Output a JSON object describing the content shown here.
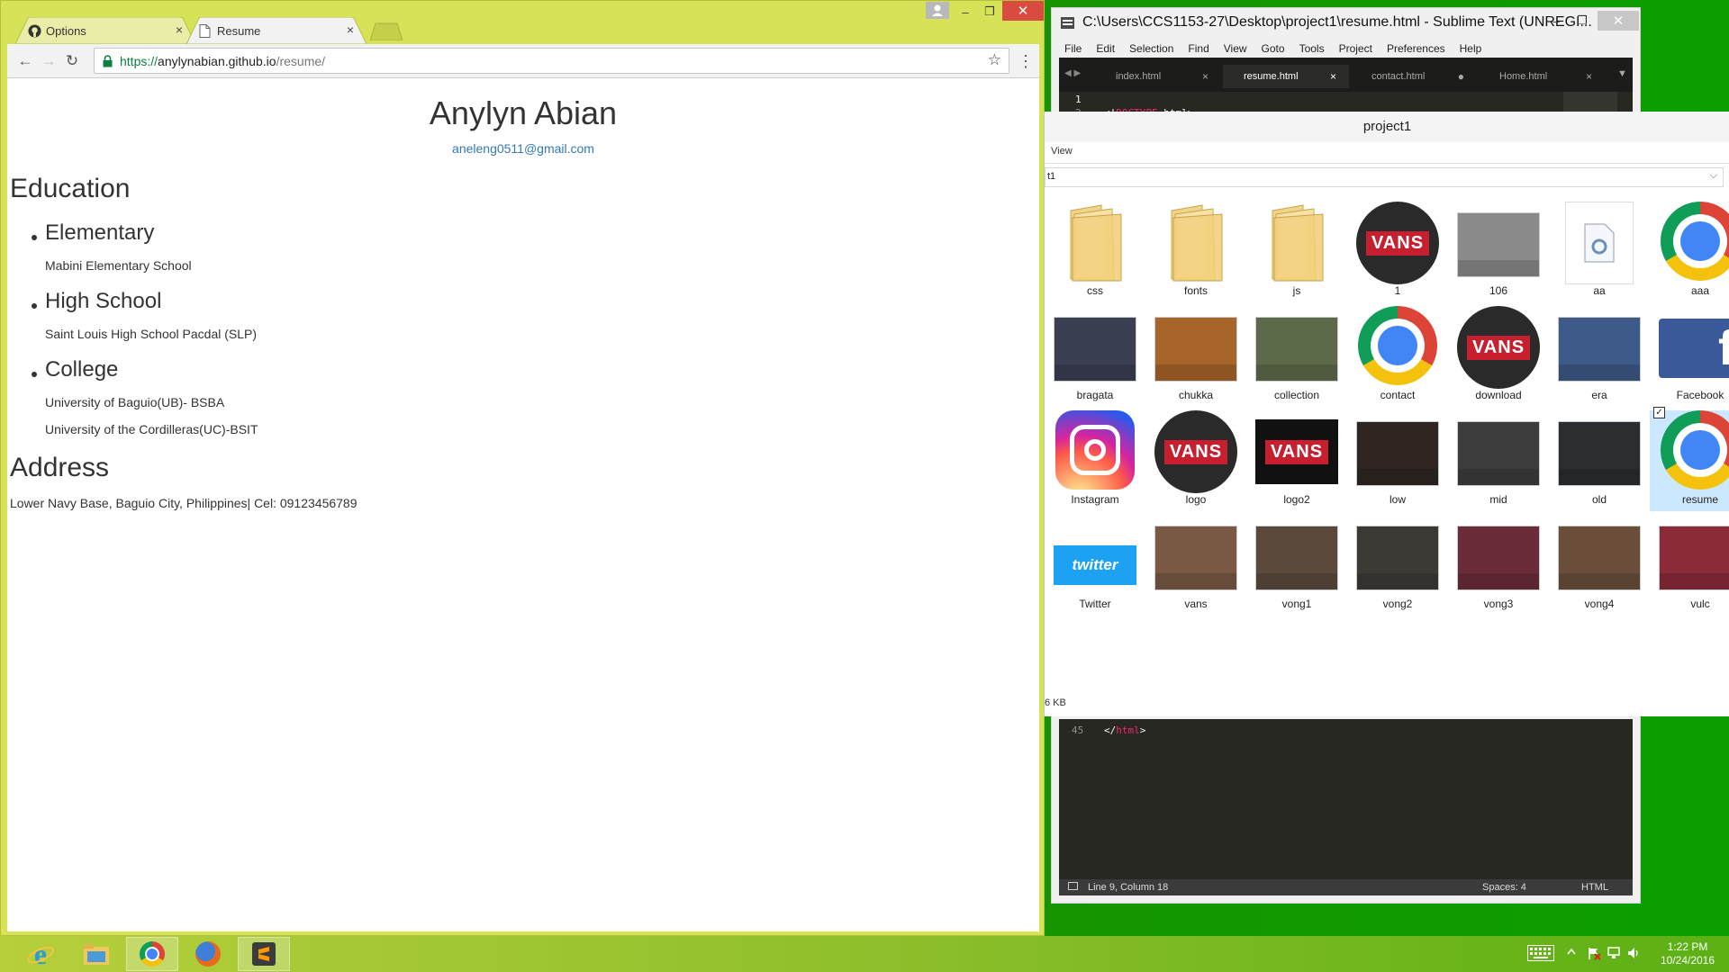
{
  "chrome": {
    "tabs": [
      {
        "label": "Options",
        "close": "×"
      },
      {
        "label": "Resume",
        "close": "×"
      }
    ],
    "window_controls": {
      "minimize": "–",
      "maximize": "❐",
      "close": "✕"
    },
    "url_protocol": "https://",
    "url_host": "anylynabian.github.io",
    "url_path": "/resume/",
    "back": "←",
    "forward": "→",
    "reload": "↻",
    "star": "☆",
    "menu": "⋮"
  },
  "resume": {
    "name": "Anylyn Abian",
    "email": "aneleng0511@gmail.com",
    "education_heading": "Education",
    "education": [
      {
        "level": "Elementary",
        "schools": [
          "Mabini Elementary School"
        ]
      },
      {
        "level": "High School",
        "schools": [
          "Saint Louis High School Pacdal (SLP)"
        ]
      },
      {
        "level": "College",
        "schools": [
          "University of Baguio(UB)- BSBA",
          "University of the Cordilleras(UC)-BSIT"
        ]
      }
    ],
    "address_heading": "Address",
    "address": "Lower Navy Base, Baguio City, Philippines| Cel: 09123456789"
  },
  "sublime": {
    "title": "C:\\Users\\CCS1153-27\\Desktop\\project1\\resume.html - Sublime Text (UNREGI...",
    "menu": [
      "File",
      "Edit",
      "Selection",
      "Find",
      "View",
      "Goto",
      "Tools",
      "Project",
      "Preferences",
      "Help"
    ],
    "tabs": [
      {
        "label": "index.html",
        "mark": "×"
      },
      {
        "label": "resume.html",
        "mark": "×"
      },
      {
        "label": "contact.html",
        "mark": "●"
      },
      {
        "label": "Home.html",
        "mark": "×"
      }
    ],
    "code_top": [
      {
        "line": "1",
        "text": ""
      },
      {
        "line": "2",
        "text_open": "<!",
        "keyword": "DOCTYPE",
        "text_close": " html>"
      }
    ],
    "code_bottom": {
      "line": "45",
      "open": "</",
      "keyword": "html",
      "close": ">"
    },
    "status_position": "Line 9, Column 18",
    "status_spaces": "Spaces: 4",
    "status_syntax": "HTML",
    "window_controls": {
      "minimize": "–",
      "maximize": "❐",
      "close": "✕"
    }
  },
  "explorer": {
    "title": "project1",
    "ribbon_view": "View",
    "address": "t1",
    "size_text": "6 KB",
    "items": [
      {
        "label": "css",
        "kind": "folder"
      },
      {
        "label": "fonts",
        "kind": "folder"
      },
      {
        "label": "js",
        "kind": "folder"
      },
      {
        "label": "1",
        "kind": "vans"
      },
      {
        "label": "106",
        "kind": "photo",
        "color": "#8a8a8a"
      },
      {
        "label": "aa",
        "kind": "file"
      },
      {
        "label": "aaa",
        "kind": "chrome"
      },
      {
        "label": "bragata",
        "kind": "photo",
        "color": "#3b3f52"
      },
      {
        "label": "chukka",
        "kind": "photo",
        "color": "#a8652b"
      },
      {
        "label": "collection",
        "kind": "photo",
        "color": "#5d6a4a"
      },
      {
        "label": "contact",
        "kind": "chrome"
      },
      {
        "label": "download",
        "kind": "vans"
      },
      {
        "label": "era",
        "kind": "photo",
        "color": "#3e5a88"
      },
      {
        "label": "Facebook",
        "kind": "facebook"
      },
      {
        "label": "Instagram",
        "kind": "instagram"
      },
      {
        "label": "logo",
        "kind": "vans"
      },
      {
        "label": "logo2",
        "kind": "vans-black"
      },
      {
        "label": "low",
        "kind": "photo",
        "color": "#2f2622"
      },
      {
        "label": "mid",
        "kind": "photo",
        "color": "#3c3c3c"
      },
      {
        "label": "old",
        "kind": "photo",
        "color": "#2b2d30"
      },
      {
        "label": "resume",
        "kind": "chrome"
      },
      {
        "label": "Twitter",
        "kind": "twitter"
      },
      {
        "label": "vans",
        "kind": "photo",
        "color": "#7a5a45"
      },
      {
        "label": "vong1",
        "kind": "photo",
        "color": "#5b4a3c"
      },
      {
        "label": "vong2",
        "kind": "photo",
        "color": "#3d3a36"
      },
      {
        "label": "vong3",
        "kind": "photo",
        "color": "#6b2c3a"
      },
      {
        "label": "vong4",
        "kind": "photo",
        "color": "#6a4e3a"
      },
      {
        "label": "vulc",
        "kind": "photo",
        "color": "#8b2b3a"
      }
    ],
    "twitter_text": "twitter",
    "vans_text": "VANS",
    "facebook_text": "f"
  },
  "taskbar": {
    "apps": [
      "internet-explorer",
      "file-explorer",
      "chrome",
      "firefox",
      "sublime-text"
    ],
    "time": "1:22 PM",
    "date": "10/24/2016"
  },
  "colors": {
    "chrome_frame": "#d7e356",
    "link": "#337ab7",
    "editor_bg": "#272822",
    "keyword": "#f92672"
  }
}
